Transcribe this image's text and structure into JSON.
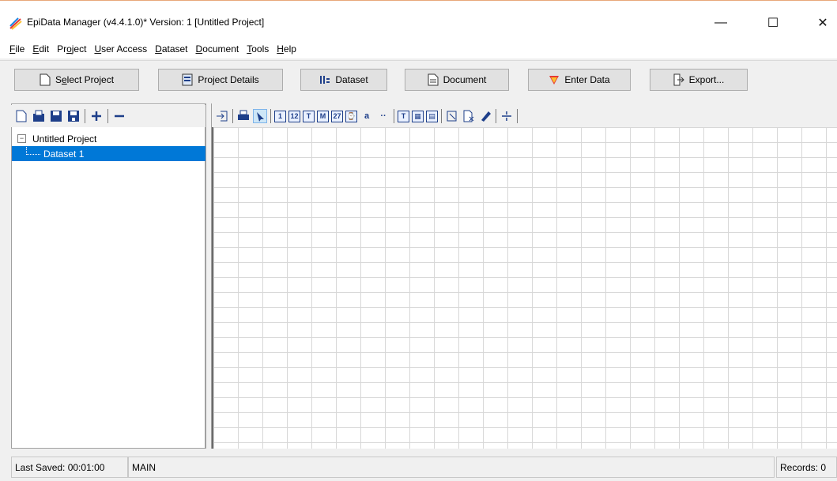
{
  "window": {
    "title": "EpiData Manager (v4.4.1.0)* Version: 1 [Untitled Project]",
    "controls": {
      "minimize": "—",
      "maximize": "☐",
      "close": "✕"
    }
  },
  "menu": {
    "items": [
      {
        "mnemonic": "F",
        "rest": "ile"
      },
      {
        "mnemonic": "E",
        "rest": "dit"
      },
      {
        "pre": "Pr",
        "mnemonic": "o",
        "rest": "ject"
      },
      {
        "mnemonic": "U",
        "rest": "ser Access"
      },
      {
        "mnemonic": "D",
        "rest": "ataset"
      },
      {
        "mnemonic": "D",
        "rest": "ocument"
      },
      {
        "mnemonic": "T",
        "rest": "ools"
      },
      {
        "mnemonic": "H",
        "rest": "elp"
      }
    ]
  },
  "toolbar": {
    "select_project": {
      "pre": "S",
      "mnemonic": "e",
      "rest": "lect Project"
    },
    "project_details": "Project Details",
    "dataset": "Dataset",
    "document": "Document",
    "enter_data": "Enter Data",
    "export": "Export..."
  },
  "tree": {
    "root": "Untitled Project",
    "expander": "−",
    "children": [
      "Dataset 1"
    ]
  },
  "status": {
    "last_saved": "Last Saved: 00:01:00",
    "mode": "MAIN",
    "records": "Records: 0"
  },
  "colors": {
    "selection": "#0078d7",
    "accent_icon": "#1e3f8a"
  }
}
